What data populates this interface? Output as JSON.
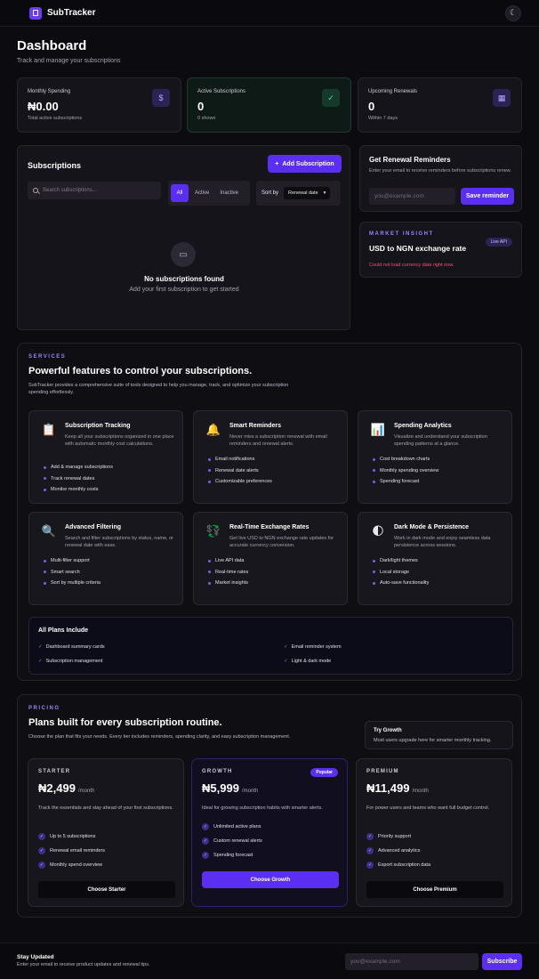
{
  "app": {
    "name": "SubTracker"
  },
  "header": {
    "title": "Dashboard",
    "subtitle": "Track and manage your subscriptions"
  },
  "stats": [
    {
      "label": "Monthly Spending",
      "value": "₦0.00",
      "sub": "Total active subscriptions",
      "icon": "dollar-icon",
      "icon_glyph": "$"
    },
    {
      "label": "Active Subscriptions",
      "value": "0",
      "sub": "0 shown",
      "icon": "check-circle-icon",
      "icon_glyph": "✓"
    },
    {
      "label": "Upcoming Renewals",
      "value": "0",
      "sub": "Within 7 days",
      "icon": "calendar-icon",
      "icon_glyph": "▦"
    }
  ],
  "subscriptions": {
    "title": "Subscriptions",
    "add_button": "Add Subscription",
    "search_placeholder": "Search subscriptions...",
    "filters": [
      "All",
      "Active",
      "Inactive"
    ],
    "sort_label": "Sort by",
    "sort_value": "Renewal date",
    "empty_title": "No subscriptions found",
    "empty_sub": "Add your first subscription to get started"
  },
  "reminders": {
    "title": "Get Renewal Reminders",
    "desc": "Enter your email to receive reminders before subscriptions renew.",
    "placeholder": "you@example.com",
    "button": "Save reminder"
  },
  "market": {
    "kicker": "MARKET INSIGHT",
    "title": "USD to NGN exchange rate",
    "badge": "Live API",
    "error": "Could not load currency data right now."
  },
  "services": {
    "kicker": "SERVICES",
    "heading": "Powerful features to control your subscriptions.",
    "desc": "SubTracker provides a comprehensive suite of tools designed to help you manage, track, and optimize your subscription spending effortlessly.",
    "features": [
      {
        "title": "Subscription Tracking",
        "desc": "Keep all your subscriptions organized in one place with automatic monthly cost calculations.",
        "icon": "clipboard-icon",
        "glyph": "📋",
        "items": [
          "Add & manage subscriptions",
          "Track renewal dates",
          "Monitor monthly costs"
        ]
      },
      {
        "title": "Smart Reminders",
        "desc": "Never miss a subscription renewal with email reminders and renewal alerts.",
        "icon": "bell-icon",
        "glyph": "🔔",
        "items": [
          "Email notifications",
          "Renewal date alerts",
          "Customizable preferences"
        ]
      },
      {
        "title": "Spending Analytics",
        "desc": "Visualize and understand your subscription spending patterns at a glance.",
        "icon": "bar-chart-icon",
        "glyph": "📊",
        "items": [
          "Cost breakdown charts",
          "Monthly spending overview",
          "Spending forecast"
        ]
      },
      {
        "title": "Advanced Filtering",
        "desc": "Search and filter subscriptions by status, name, or renewal date with ease.",
        "icon": "magnifier-icon",
        "glyph": "🔍",
        "items": [
          "Multi-filter support",
          "Smart search",
          "Sort by multiple criteria"
        ]
      },
      {
        "title": "Real-Time Exchange Rates",
        "desc": "Get live USD to NGN exchange rate updates for accurate currency conversion.",
        "icon": "currency-exchange-icon",
        "glyph": "💱",
        "items": [
          "Live API data",
          "Real-time rates",
          "Market insights"
        ]
      },
      {
        "title": "Dark Mode & Persistence",
        "desc": "Work in dark mode and enjoy seamless data persistence across sessions.",
        "icon": "half-moon-icon",
        "glyph": "🌓",
        "items": [
          "Dark/light themes",
          "Local storage",
          "Auto-save functionality"
        ]
      }
    ],
    "all_plans_title": "All Plans Include",
    "all_plans_items": [
      "Dashboard summary cards",
      "Email reminder system",
      "Subscription management",
      "Light & dark mode"
    ]
  },
  "pricing": {
    "kicker": "PRICING",
    "heading": "Plans built for every subscription routine.",
    "desc": "Choose the plan that fits your needs. Every tier includes reminders, spending clarity, and easy subscription management.",
    "try_title": "Try Growth",
    "try_desc": "Most users upgrade here for smarter monthly tracking.",
    "per": "/month",
    "plans": [
      {
        "name": "STARTER",
        "price": "₦2,499",
        "desc": "Track the essentials and stay ahead of your first subscriptions.",
        "features": [
          "Up to 5 subscriptions",
          "Renewal email reminders",
          "Monthly spend overview"
        ],
        "button": "Choose Starter"
      },
      {
        "name": "GROWTH",
        "price": "₦5,999",
        "badge": "Popular",
        "desc": "Ideal for growing subscription habits with smarter alerts.",
        "features": [
          "Unlimited active plans",
          "Custom renewal alerts",
          "Spending forecast"
        ],
        "button": "Choose Growth"
      },
      {
        "name": "PREMIUM",
        "price": "₦11,499",
        "desc": "For power users and teams who want full budget control.",
        "features": [
          "Priority support",
          "Advanced analytics",
          "Export subscription data"
        ],
        "button": "Choose Premium"
      }
    ]
  },
  "footer": {
    "title": "Stay Updated",
    "desc": "Enter your email to receive product updates and renewal tips.",
    "placeholder": "you@example.com",
    "button": "Subscribe"
  },
  "colors": {
    "accent": "#5b2ff2",
    "background": "#0c0b10",
    "error": "#ff4d6a"
  }
}
